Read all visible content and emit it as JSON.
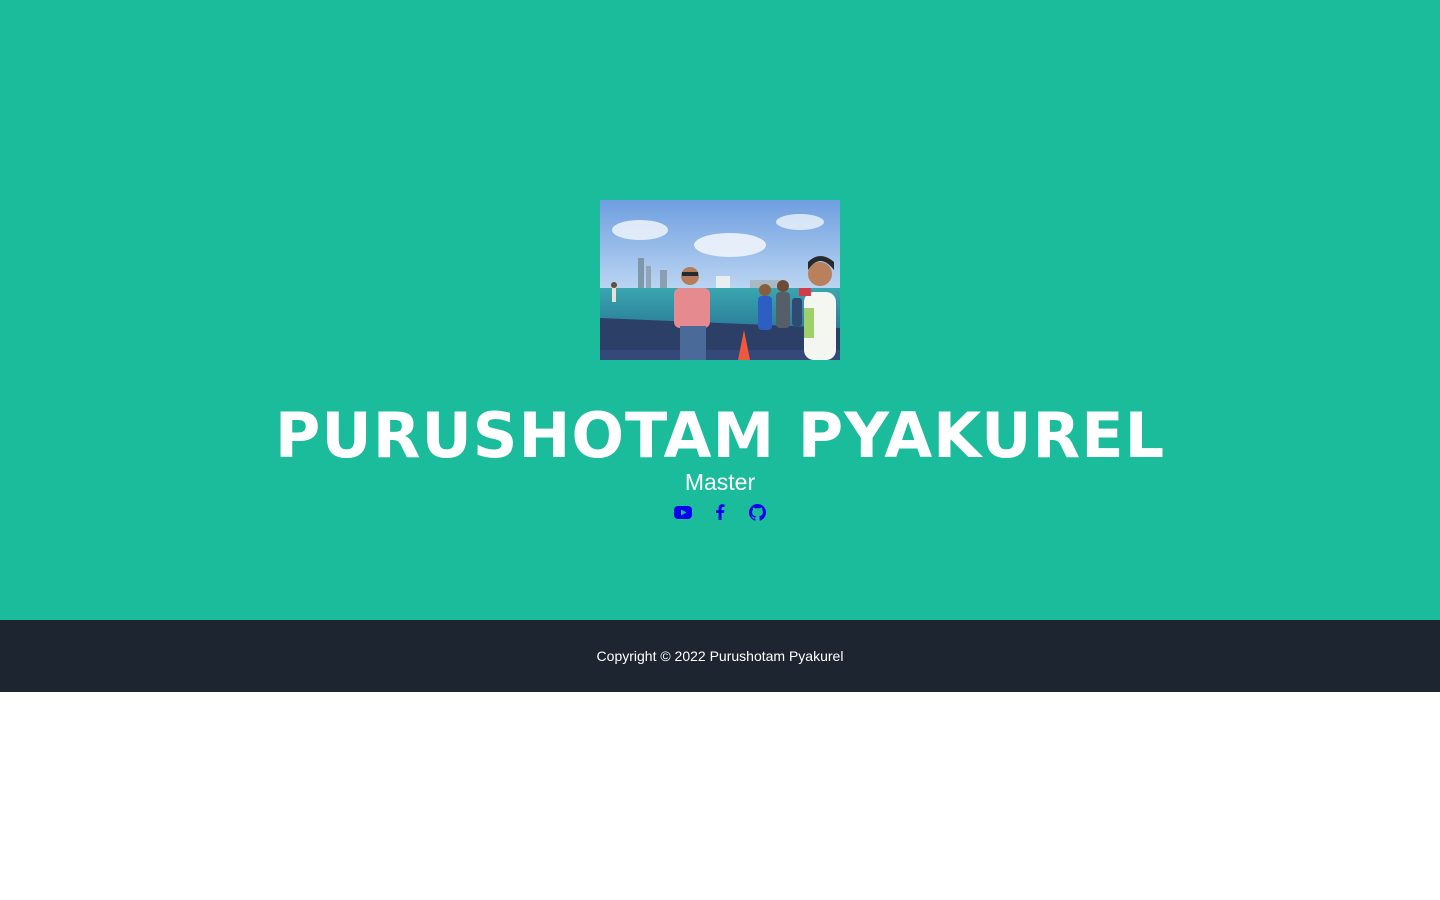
{
  "masthead": {
    "name": "PURUSHOTAM PYAKUREL",
    "role": "Master",
    "background_color": "#1abc9c",
    "photo_icon": "profile-photo",
    "social_links": [
      {
        "icon": "youtube-icon",
        "color": "#0000ee"
      },
      {
        "icon": "facebook-icon",
        "color": "#0000ee"
      },
      {
        "icon": "github-icon",
        "color": "#0000ee"
      }
    ]
  },
  "footer": {
    "copyright": "Copyright © 2022 Purushotam Pyakurel",
    "background_color": "#1d2530"
  }
}
